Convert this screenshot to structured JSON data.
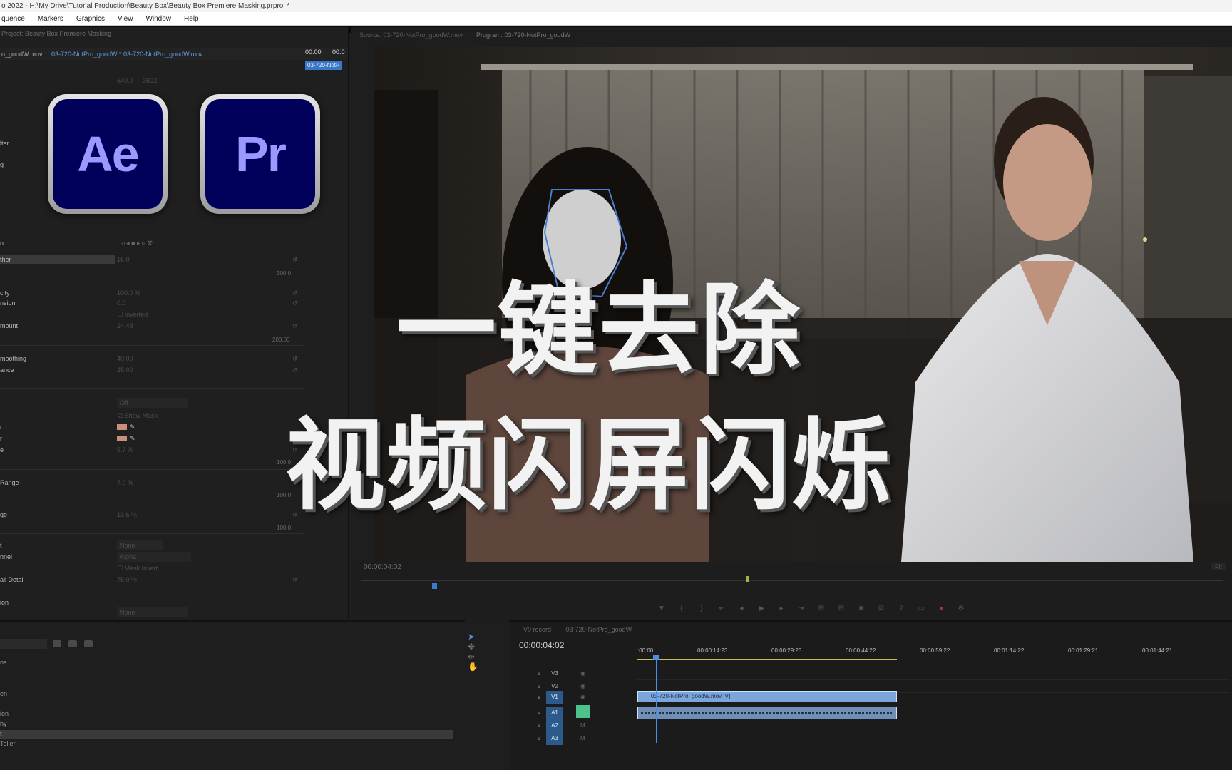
{
  "window": {
    "title": "o 2022 - H:\\My Drive\\Tutorial Production\\Beauty Box\\Beauty Box Premiere Masking.prproj *"
  },
  "menu": [
    "quence",
    "Markers",
    "Graphics",
    "View",
    "Window",
    "Help"
  ],
  "effect_controls": {
    "project_tab": "Project: Beauty Box Premiere Masking",
    "clip_name": "o_goodW.mov",
    "sequence_label": "03-720-NotPro_goodW * 03-720-NotPro_goodW.mov",
    "ruler": [
      "00:00",
      "00:0"
    ],
    "mini_clip": "03-720-NotP",
    "values_top": [
      "640.0",
      "360.0"
    ],
    "rows": [
      {
        "name": "lter",
        "value": ""
      },
      {
        "name": "g",
        "value": ""
      },
      {
        "name": "n",
        "value": ""
      },
      {
        "name": "ther",
        "value": "16.0"
      },
      {
        "name": "",
        "value": "300.0"
      },
      {
        "name": "city",
        "value": "100.0 %"
      },
      {
        "name": "nsion",
        "value": "0.0"
      },
      {
        "name": "",
        "value": "Inverted"
      },
      {
        "name": "mount",
        "value": "24.48"
      },
      {
        "name": "",
        "value": "200.00"
      },
      {
        "name": "moothing",
        "value": "40.00"
      },
      {
        "name": "ance",
        "value": "25.00"
      },
      {
        "name": "",
        "value": "Off"
      },
      {
        "name": "",
        "value": "Show Mask"
      },
      {
        "name": "r",
        "value": ""
      },
      {
        "name": "r",
        "value": ""
      },
      {
        "name": "e",
        "value": "5.7 %"
      },
      {
        "name": "",
        "value": "100.0"
      },
      {
        "name": "Range",
        "value": "7.9 %"
      },
      {
        "name": "",
        "value": "100.0"
      },
      {
        "name": "ge",
        "value": "13.6 %"
      },
      {
        "name": "",
        "value": "100.0"
      },
      {
        "name": "t",
        "value": "None"
      },
      {
        "name": "nnel",
        "value": "Alpha"
      },
      {
        "name": "",
        "value": "Mask Invert"
      },
      {
        "name": "all Detail",
        "value": "75.0 %"
      },
      {
        "name": "ion",
        "value": ""
      },
      {
        "name": "",
        "value": "None"
      },
      {
        "name": "al",
        "value": ""
      }
    ]
  },
  "logos": {
    "ae": "Ae",
    "pr": "Pr"
  },
  "monitor": {
    "source_tab": "Source: 03-720-NotPro_goodW.mov",
    "program_tab": "Program: 03-720-NotPro_goodW",
    "timecode": "00:00:04:02",
    "fit": "Fit"
  },
  "overlay": {
    "line1": "一键去除",
    "line2": "视频闪屏闪烁"
  },
  "project_panel": {
    "rows": [
      "ns",
      "en",
      "ion",
      "hy",
      "t",
      "Teller"
    ]
  },
  "timeline": {
    "tabs": [
      "V0 record",
      "03-720-NotPro_goodW"
    ],
    "timecode": "00:00:04:02",
    "ruler": [
      ":00:00",
      "00:00:14:23",
      "00:00:29:23",
      "00:00:44:22",
      "00:00:59:22",
      "00:01:14:22",
      "00:01:29:21",
      "00:01:44:21"
    ],
    "tracks": [
      {
        "label": "V3",
        "active": false
      },
      {
        "label": "V2",
        "active": false
      },
      {
        "label": "V1",
        "active": true
      },
      {
        "label": "A1",
        "active": true
      },
      {
        "label": "A2",
        "active": true
      },
      {
        "label": "A3",
        "active": true
      }
    ],
    "video_clip": "03-720-NotPro_goodW.mov [V]"
  }
}
